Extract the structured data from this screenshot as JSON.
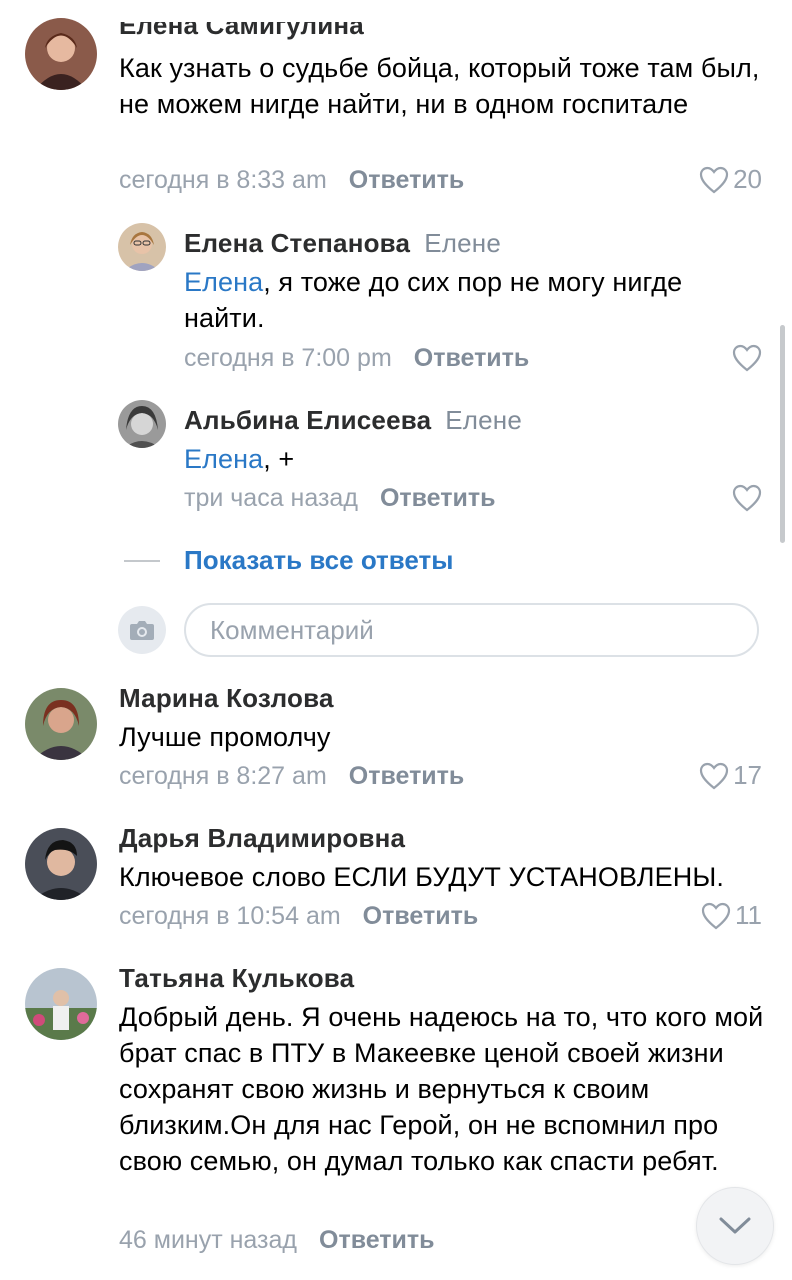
{
  "comments": [
    {
      "author": "Елена Самигулина",
      "text": "Как узнать о судьбе бойца, который тоже там был, не можем нигде найти, ни в одном госпитале",
      "time": "сегодня в 8:33 am",
      "reply_label": "Ответить",
      "likes": "20"
    },
    {
      "author": "Марина Козлова",
      "text": "Лучше промолчу",
      "time": "сегодня в 8:27 am",
      "reply_label": "Ответить",
      "likes": "17"
    },
    {
      "author": "Дарья Владимировна",
      "text": "Ключевое слово ЕСЛИ БУДУТ УСТАНОВЛЕНЫ.",
      "time": "сегодня в 10:54 am",
      "reply_label": "Ответить",
      "likes": "11"
    },
    {
      "author": "Татьяна Кулькова",
      "text": "Добрый день. Я очень надеюсь на то, что кого мой брат спас в ПТУ в Макеевке ценой своей жизни сохранят свою жизнь и вернуться к своим близким.Он для нас Герой, он не вспомнил про свою семью, он думал только как спасти ребят.",
      "time": "46 минут назад",
      "reply_label": "Ответить"
    }
  ],
  "replies": [
    {
      "author": "Елена Степанова",
      "reply_to": "Елене",
      "mention": "Елена",
      "text": ", я тоже до сих пор не могу нигде найти.",
      "time": "сегодня в 7:00 pm",
      "reply_label": "Ответить"
    },
    {
      "author": "Альбина Елисеева",
      "reply_to": "Елене",
      "mention": "Елена",
      "text": ", +",
      "time": "три часа назад",
      "reply_label": "Ответить"
    }
  ],
  "show_all_replies": "Показать все ответы",
  "comment_input": {
    "placeholder": "Комментарий"
  },
  "colors": {
    "link": "#2a78c6",
    "secondary": "#818c99",
    "meta": "#99a2ad"
  }
}
